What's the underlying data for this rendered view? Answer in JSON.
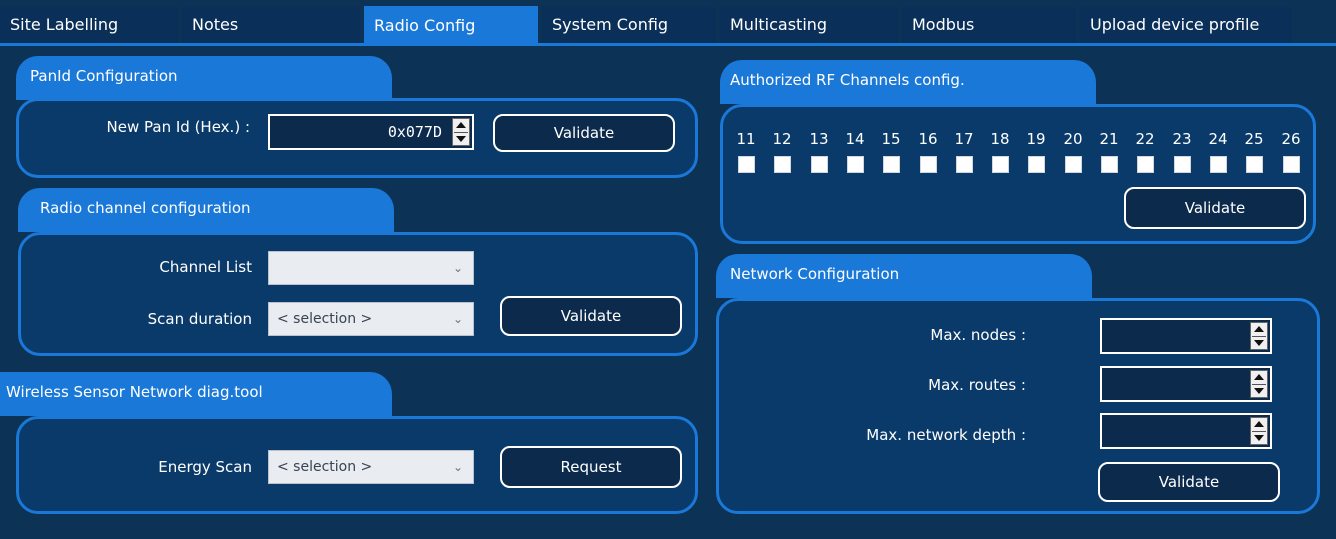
{
  "tabs": [
    {
      "label": "Site Labelling",
      "active": false
    },
    {
      "label": "Notes",
      "active": false
    },
    {
      "label": "Radio Config",
      "active": true
    },
    {
      "label": "System Config",
      "active": false
    },
    {
      "label": "Multicasting",
      "active": false
    },
    {
      "label": "Modbus",
      "active": false
    },
    {
      "label": "Upload device profile",
      "active": false
    }
  ],
  "panid": {
    "title": "PanId Configuration",
    "label": "New Pan Id (Hex.) :",
    "value": "0x077D",
    "validate_label": "Validate"
  },
  "radio_channel": {
    "title": "Radio channel configuration",
    "channel_list_label": "Channel List",
    "channel_list_value": "",
    "scan_duration_label": "Scan duration",
    "scan_duration_value": "< selection >",
    "validate_label": "Validate"
  },
  "wsn_diag": {
    "title": "Wireless Sensor Network diag.tool",
    "energy_scan_label": "Energy Scan",
    "energy_scan_value": "< selection >",
    "request_label": "Request"
  },
  "rf_channels": {
    "title": "Authorized RF Channels config.",
    "channels": [
      "11",
      "12",
      "13",
      "14",
      "15",
      "16",
      "17",
      "18",
      "19",
      "20",
      "21",
      "22",
      "23",
      "24",
      "25",
      "26"
    ],
    "validate_label": "Validate"
  },
  "network": {
    "title": "Network Configuration",
    "max_nodes_label": "Max. nodes :",
    "max_routes_label": "Max. routes :",
    "max_depth_label": "Max. network depth :",
    "max_nodes_value": "",
    "max_routes_value": "",
    "max_depth_value": "",
    "validate_label": "Validate"
  },
  "colors": {
    "background": "#0c3256",
    "accent": "#1a78d8",
    "panel": "#0a3a6a"
  }
}
